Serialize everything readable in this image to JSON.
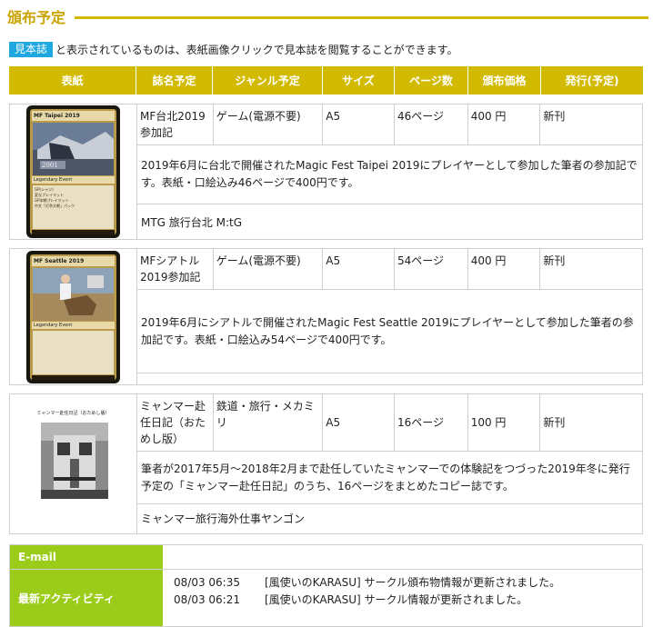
{
  "section": {
    "title": "頒布予定"
  },
  "legend": {
    "badge": "見本誌",
    "text": "と表示されているものは、表紙画像クリックで見本誌を閲覧することができます。"
  },
  "table_headers": {
    "cover": "表紙",
    "title": "誌名予定",
    "genre": "ジャンル予定",
    "size": "サイズ",
    "pages": "ページ数",
    "price": "頒布価格",
    "issue": "発行(予定)"
  },
  "items": [
    {
      "title": "MF台北2019参加記",
      "genre": "ゲーム(電源不要)",
      "size": "A5",
      "pages": "46ページ",
      "price": "400 円",
      "issue": "新刊",
      "description": "2019年6月に台北で開催されたMagic Fest Taipei 2019にプレイヤーとして参加した筆者の参加記です。表紙・口絵込み46ページで400円です。",
      "tags": "MTG 旅行台北 M:tG",
      "cover_card": {
        "name": "MF Taipei 2019",
        "type": "Legendary Event",
        "art_caption": "2001",
        "lines": [
          "GP(シャツ)",
          "変なプレイマット",
          "GP本戦プレイマット",
          "中文「灯争大戦」パック"
        ]
      }
    },
    {
      "title": "MFシアトル2019参加記",
      "genre": "ゲーム(電源不要)",
      "size": "A5",
      "pages": "54ページ",
      "price": "400 円",
      "issue": "新刊",
      "description": "2019年6月にシアトルで開催されたMagic Fest Seattle 2019にプレイヤーとして参加した筆者の参加記です。表紙・口絵込み54ページで400円です。",
      "tags": "",
      "cover_card": {
        "name": "MF Seattle 2019",
        "type": "Legendary Event",
        "art_caption": "",
        "lines": []
      }
    },
    {
      "title": "ミャンマー赴任日記（おためし版）",
      "genre": "鉄道・旅行・メカミリ",
      "size": "A5",
      "pages": "16ページ",
      "price": "100 円",
      "issue": "新刊",
      "description": "筆者が2017年5月～2018年2月まで赴任していたミャンマーでの体験記をつづった2019年冬に発行予定の「ミャンマー赴任日記」のうち、16ページをまとめたコピー誌です。",
      "tags": "ミャンマー旅行海外仕事ヤンゴン",
      "cover_doc": {
        "heading": "ミャンマー赴任日記（おためし版）"
      }
    }
  ],
  "footer": {
    "email_label": "E-mail",
    "email_value": "",
    "activity_label": "最新アクティビティ",
    "activities": [
      {
        "time": "08/03 06:35",
        "text": "[風使いのKARASU] サークル頒布物情報が更新されました。"
      },
      {
        "time": "08/03 06:21",
        "text": "[風使いのKARASU] サークル情報が更新されました。"
      }
    ]
  },
  "colors": {
    "accent_gold": "#d2ba00",
    "title_gold": "#c9a400",
    "badge_blue": "#1fa8e0",
    "footer_green": "#9ccc1a"
  }
}
